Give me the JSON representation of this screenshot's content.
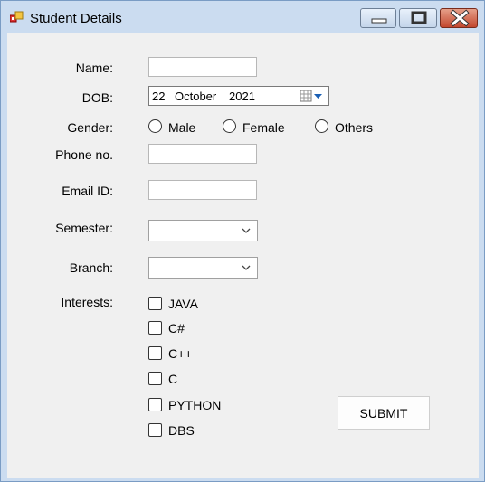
{
  "window": {
    "title": "Student Details"
  },
  "form": {
    "name_label": "Name:",
    "dob_label": "DOB:",
    "dob": {
      "day": "22",
      "month": "October",
      "year": "2021"
    },
    "gender_label": "Gender:",
    "gender_options": [
      "Male",
      "Female",
      "Others"
    ],
    "phone_label": "Phone no.",
    "email_label": "Email ID:",
    "semester_label": "Semester:",
    "branch_label": "Branch:",
    "interests_label": "Interests:",
    "interests": [
      "JAVA",
      "C#",
      "C++",
      "C",
      "PYTHON",
      "DBS"
    ],
    "submit_label": "SUBMIT"
  }
}
